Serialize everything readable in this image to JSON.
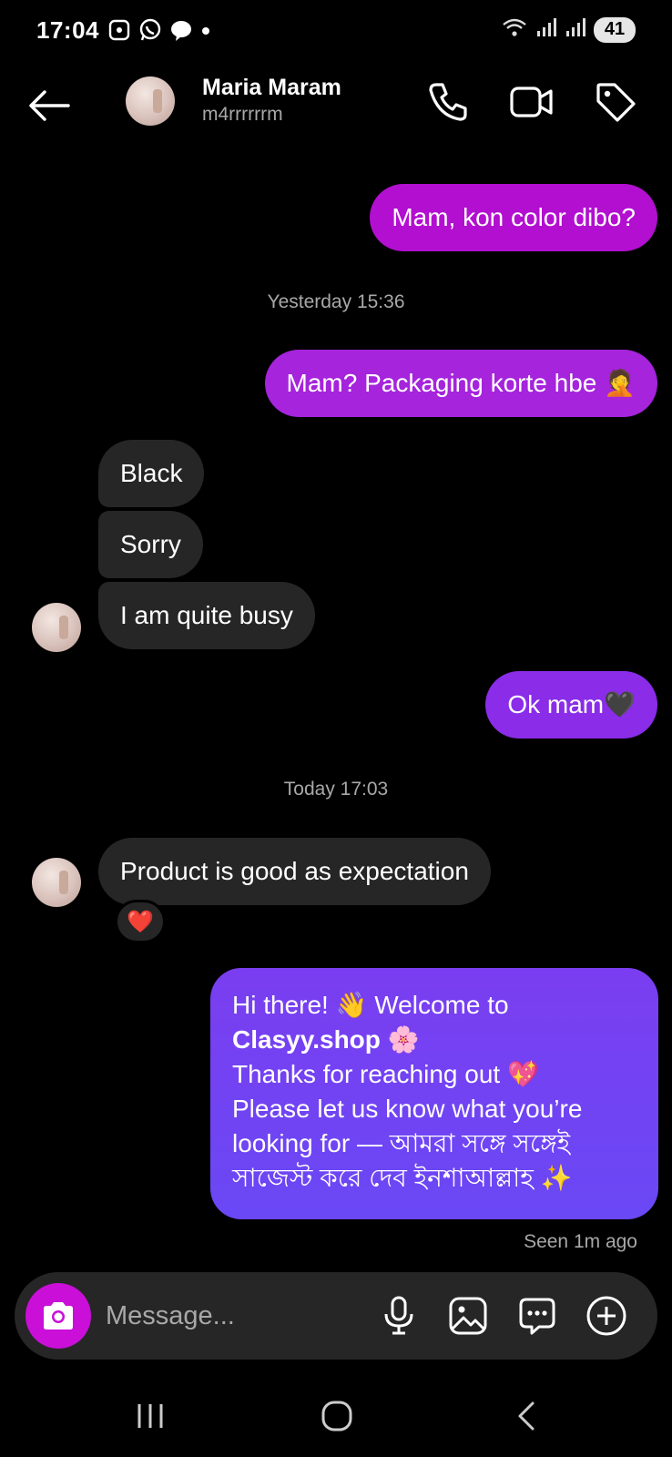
{
  "status_bar": {
    "time": "17:04",
    "battery": "41",
    "icons_left": [
      "screenshot-icon",
      "whatsapp-icon",
      "messenger-icon",
      "dot-icon"
    ],
    "icons_right": [
      "wifi-icon",
      "signal-icon",
      "signal-icon"
    ]
  },
  "header": {
    "name": "Maria Maram",
    "username": "m4rrrrrrm",
    "actions": [
      "phone-icon",
      "video-icon",
      "tag-icon"
    ]
  },
  "messages": [
    {
      "from": "me",
      "text": "Mam, kon color dibo?"
    },
    {
      "timestamp": "Yesterday 15:36"
    },
    {
      "from": "me",
      "text": "Mam? Packaging korte hbe 🤦"
    },
    {
      "from": "them",
      "text": "Black"
    },
    {
      "from": "them",
      "text": "Sorry"
    },
    {
      "from": "them",
      "text": "I am quite busy"
    },
    {
      "from": "me",
      "text": "Ok mam🖤"
    },
    {
      "timestamp": "Today 17:03"
    },
    {
      "from": "them",
      "text": "Product is good as expectation",
      "reaction": "❤️"
    }
  ],
  "welcome_message": {
    "line1": "Hi there! 👋 Welcome to",
    "brand": "Clasyy.shop",
    "brand_emoji": "🌸",
    "line3": "Thanks for reaching out 💖",
    "line4": "Please let us know what you’re",
    "line5": "looking for — আমরা সঙ্গে সঙ্গেই",
    "line6": "সাজেস্ট করে দেব ইনশাআল্লাহ ✨"
  },
  "seen_status": "Seen 1m ago",
  "composer": {
    "placeholder": "Message...",
    "icons": [
      "camera-icon",
      "microphone-icon",
      "gallery-icon",
      "sticker-icon",
      "plus-icon"
    ]
  },
  "colors": {
    "background": "#000000",
    "incoming_bubble": "#262626",
    "outgoing_magenta": "#b30fd0",
    "outgoing_purple": "#a524dc",
    "outgoing_violet": "#8a2ce8",
    "welcome_bubble": "#6a48f5",
    "camera_button": "#c90fd8"
  }
}
